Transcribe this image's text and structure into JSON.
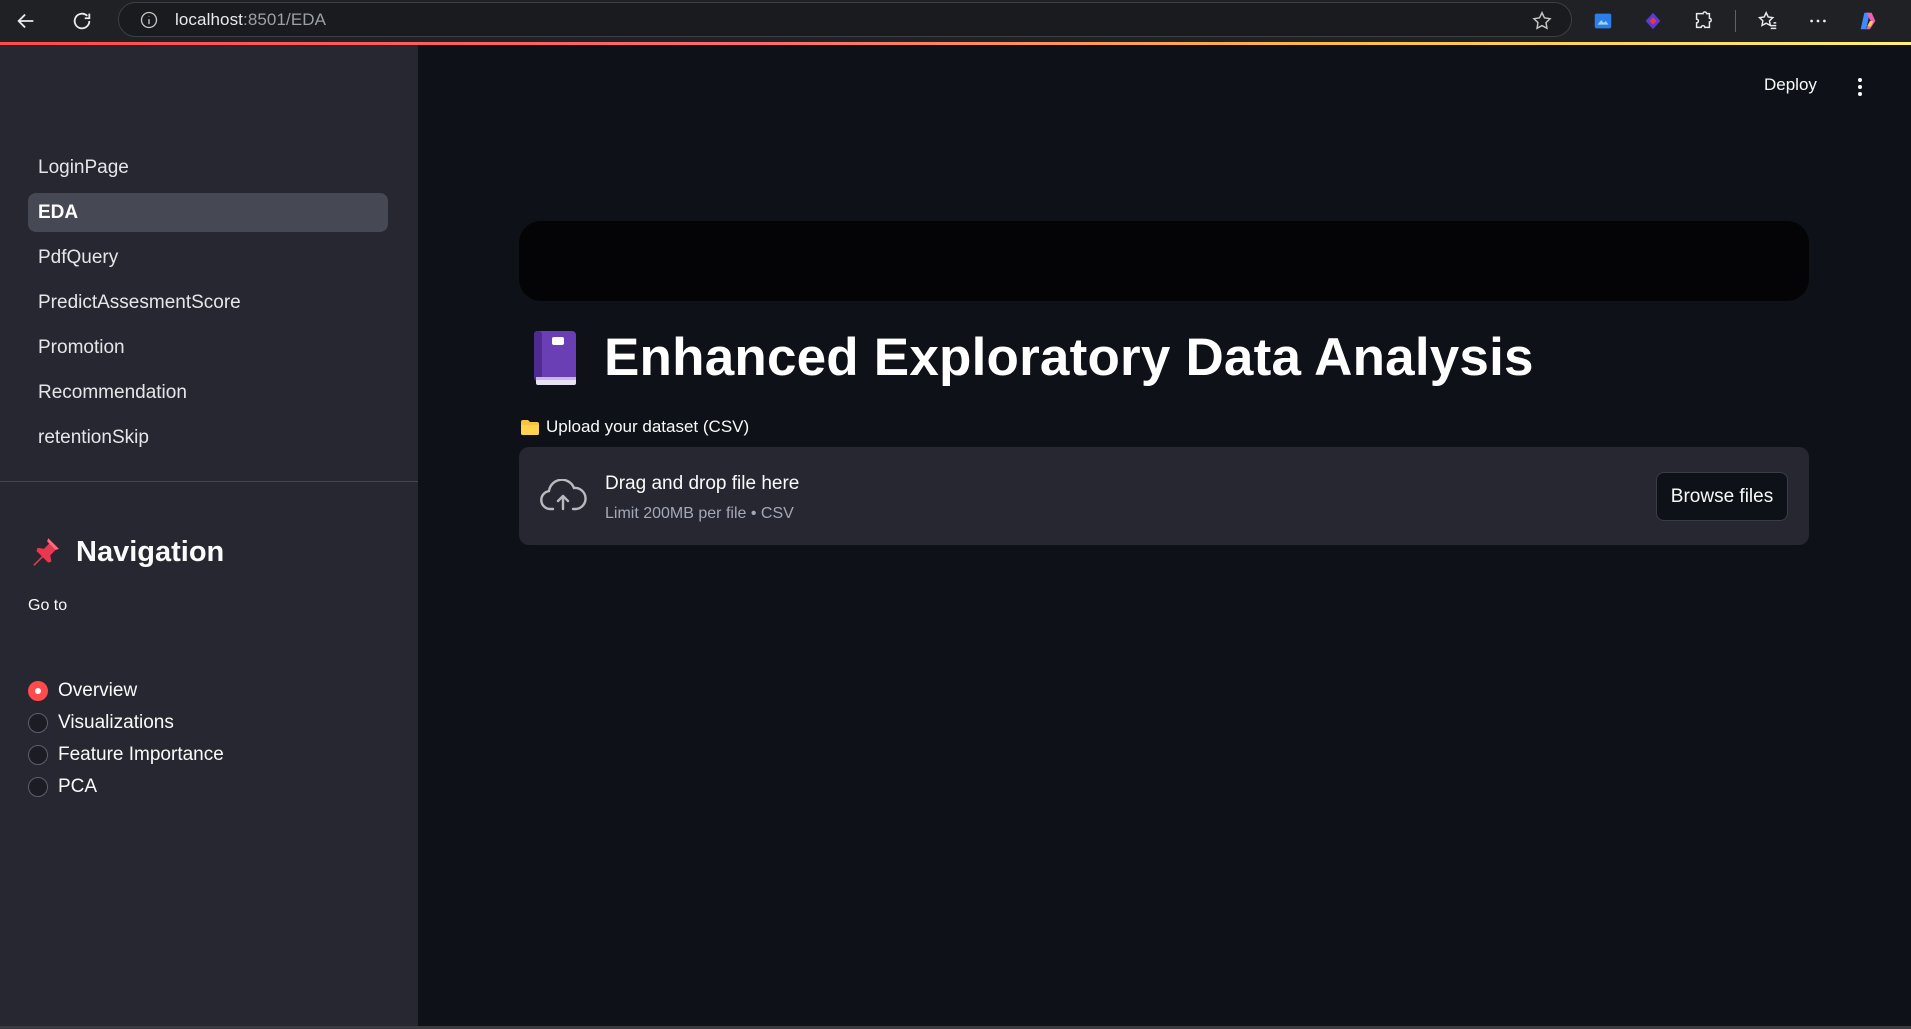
{
  "browser": {
    "url_host": "localhost",
    "url_path": ":8501/EDA"
  },
  "sidebar": {
    "pages": [
      {
        "label": "LoginPage",
        "active": false
      },
      {
        "label": "EDA",
        "active": true
      },
      {
        "label": "PdfQuery",
        "active": false
      },
      {
        "label": "PredictAssesmentScore",
        "active": false
      },
      {
        "label": "Promotion",
        "active": false
      },
      {
        "label": "Recommendation",
        "active": false
      },
      {
        "label": "retentionSkip",
        "active": false
      }
    ],
    "nav_heading": "Navigation",
    "goto_label": "Go to",
    "radio_options": [
      {
        "label": "Overview",
        "selected": true
      },
      {
        "label": "Visualizations",
        "selected": false
      },
      {
        "label": "Feature Importance",
        "selected": false
      },
      {
        "label": "PCA",
        "selected": false
      }
    ]
  },
  "header": {
    "deploy_label": "Deploy"
  },
  "main": {
    "title": "Enhanced Exploratory Data Analysis",
    "upload_label": "Upload your dataset (CSV)",
    "dropzone": {
      "main_text": "Drag and drop file here",
      "sub_text": "Limit 200MB per file • CSV",
      "browse_label": "Browse files"
    }
  },
  "colors": {
    "accent": "#ff4b4b",
    "background": "#0e1117",
    "sidebar": "#262730"
  }
}
